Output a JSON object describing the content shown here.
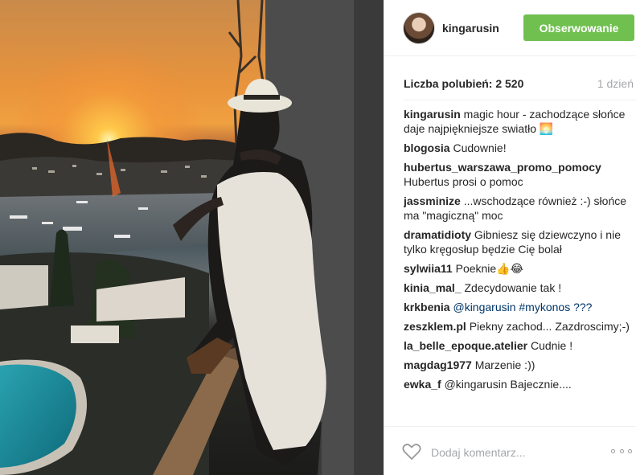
{
  "post": {
    "image_description_icon": "sunset-photo"
  },
  "header": {
    "username": "kingarusin",
    "follow_label": "Obserwowanie"
  },
  "stats": {
    "likes": "Liczba polubień: 2 520",
    "age": "1 dzień"
  },
  "comments": [
    {
      "author": "kingarusin",
      "text": " magic hour - zachodzące słońce daje najpiękniejsze swiatło 🌅"
    },
    {
      "author": "blogosia",
      "text": " Cudownie!"
    },
    {
      "author": "hubertus_warszawa_promo_pomocy",
      "text": " Hubertus prosi o pomoc"
    },
    {
      "author": "jassminize",
      "text": " ...wschodzące również :-) słońce ma \"magiczną\" moc"
    },
    {
      "author": "dramatidioty",
      "text": " Gibniesz się dziewczyno i nie tylko kręgosłup będzie Cię bolał"
    },
    {
      "author": "sylwiia11",
      "text": " Poeknie👍😂"
    },
    {
      "author": "kinia_mal_",
      "text": " Zdecydowanie tak !"
    },
    {
      "author": "krkbenia",
      "text": " @kingarusin #mykonos ???"
    },
    {
      "author": "zeszklem.pl",
      "text": " Piekny zachod... Zazdroscimy;-)"
    },
    {
      "author": "la_belle_epoque.atelier",
      "text": " Cudnie !"
    },
    {
      "author": "magdag1977",
      "text": " Marzenie :))"
    },
    {
      "author": "ewka_f",
      "text": " @kingarusin Bajecznie...."
    }
  ],
  "footer": {
    "comment_placeholder": "Dodaj komentarz...",
    "like_icon": "heart-icon",
    "more_icon": "more-options-icon"
  }
}
